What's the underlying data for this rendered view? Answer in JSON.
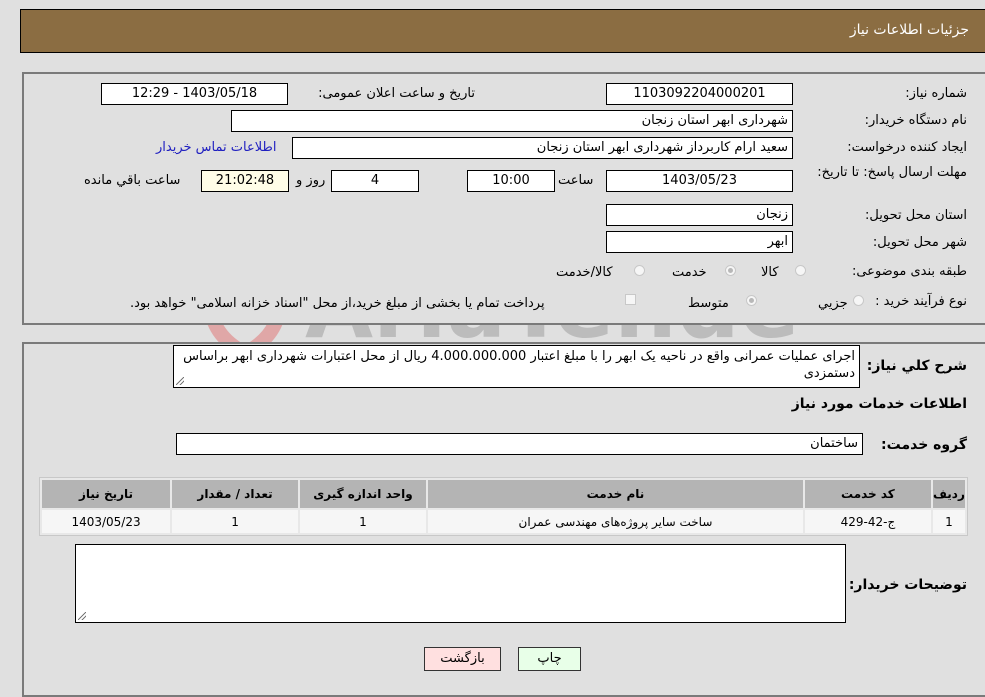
{
  "header": {
    "title": "جزئیات اطلاعات نیاز"
  },
  "form": {
    "need_number": {
      "label": "شماره نیاز:",
      "value": "1103092204000201"
    },
    "announce_datetime": {
      "label": "تاریخ و ساعت اعلان عمومی:",
      "value": "1403/05/18 - 12:29"
    },
    "buyer_org": {
      "label": "نام دستگاه خریدار:",
      "value": "شهرداری ابهر استان زنجان"
    },
    "requester": {
      "label": "ایجاد کننده درخواست:",
      "value": "سعید ارام کاربرداز  شهرداری ابهر استان زنجان"
    },
    "buyer_contact_link": "اطلاعات تماس خریدار",
    "deadline": {
      "label": "مهلت ارسال پاسخ: تا تاریخ:",
      "date": "1403/05/23",
      "time_label": "ساعت",
      "time": "10:00",
      "days": "4",
      "days_label": "روز و",
      "remaining": "21:02:48",
      "remaining_label": "ساعت باقي مانده"
    },
    "delivery_province": {
      "label": "استان محل تحویل:",
      "value": "زنجان"
    },
    "delivery_city": {
      "label": "شهر محل تحویل:",
      "value": "ابهر"
    },
    "category": {
      "label": "طبقه بندی موضوعی:",
      "options": [
        "کالا",
        "خدمت",
        "کالا/خدمت"
      ],
      "selected": "خدمت"
    },
    "purchase_type": {
      "label": "نوع فرآیند خرید :",
      "options": [
        "جزيي",
        "متوسط"
      ],
      "selected": "متوسط",
      "treasury_note": "پرداخت تمام یا بخشی از مبلغ خرید،از محل \"اسناد خزانه اسلامی\" خواهد بود."
    }
  },
  "description": {
    "label": "شرح کلي نیاز:",
    "value": "اجرای عملیات عمرانی  واقع در ناحیه یک  ابهر   را با مبلغ اعتبار 4.000.000.000 ریال  از محل اعتبارات شهرداری ابهر براساس دستمزدی"
  },
  "services": {
    "section_title": "اطلاعات خدمات مورد نیاز",
    "group_label": "گروه خدمت:",
    "group_value": "ساختمان",
    "columns": [
      "ردیف",
      "کد خدمت",
      "نام خدمت",
      "واحد اندازه گیری",
      "تعداد / مقدار",
      "تاریخ نیاز"
    ],
    "rows": [
      [
        "1",
        "ج-42-429",
        "ساخت سایر پروژه‌های مهندسی عمران",
        "1",
        "1",
        "1403/05/23"
      ]
    ]
  },
  "buyer_notes": {
    "label": "توضیحات خریدار:",
    "value": ""
  },
  "buttons": {
    "print": "چاپ",
    "back": "بازگشت"
  },
  "watermark": {
    "text": "AriaTender.neT"
  }
}
